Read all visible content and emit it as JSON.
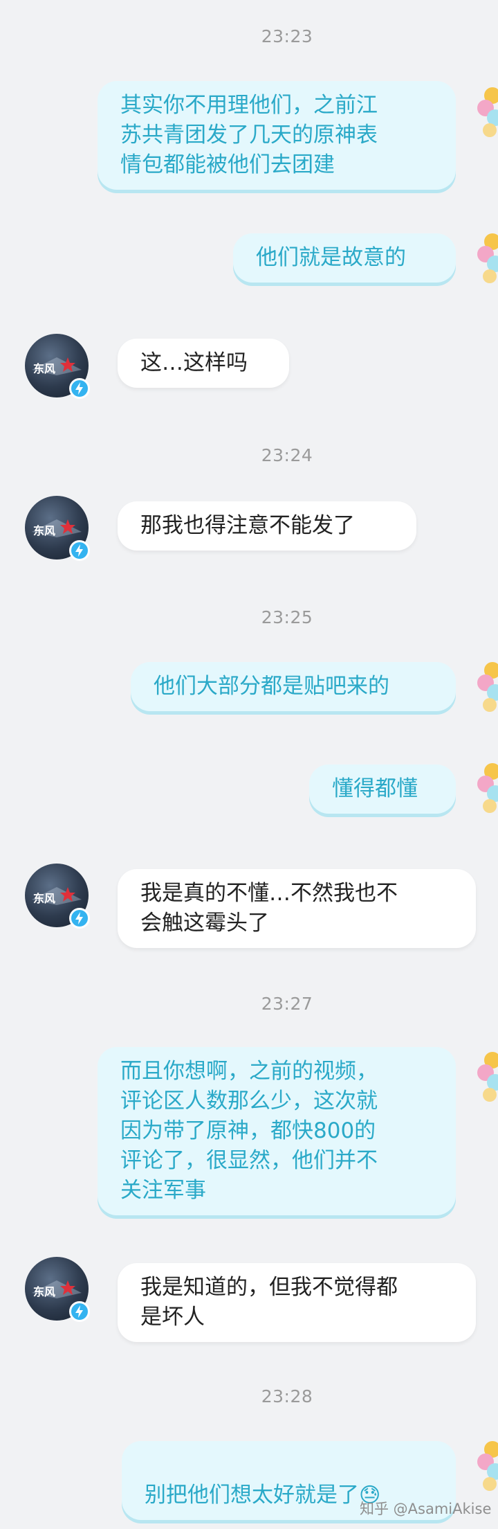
{
  "timestamps": [
    "23:23",
    "23:24",
    "23:25",
    "23:27",
    "23:28"
  ],
  "messages": {
    "m1": "其实你不用理他们，之前江\n苏共青团发了几天的原神表\n情包都能被他们去团建",
    "m2": "他们就是故意的",
    "m3": "这…这样吗",
    "m4": "那我也得注意不能发了",
    "m5": "他们大部分都是贴吧来的",
    "m6": "懂得都懂",
    "m7": "我是真的不懂…不然我也不\n会触这霉头了",
    "m8": "而且你想啊，之前的视频，\n评论区人数那么少，这次就\n因为带了原神，都快800的\n评论了，很显然，他们并不\n关注军事",
    "m9": "我是知道的，但我不觉得都\n是坏人",
    "m10": "别把他们想太好就是了"
  },
  "emoji": "😓",
  "watermark": "知乎 @AsamiAkise",
  "colors": {
    "background": "#f1f2f4",
    "outgoing_bubble": "#e4f8fd",
    "outgoing_text": "#2aa9c8",
    "incoming_bubble": "#ffffff",
    "incoming_text": "#222222",
    "timestamp": "#9a9a9a",
    "badge": "#34b3f0"
  },
  "icons": {
    "contact_avatar": "contact-avatar-icon",
    "verified_badge": "lightning-badge-icon",
    "self_avatar": "flower-avatar-icon"
  }
}
